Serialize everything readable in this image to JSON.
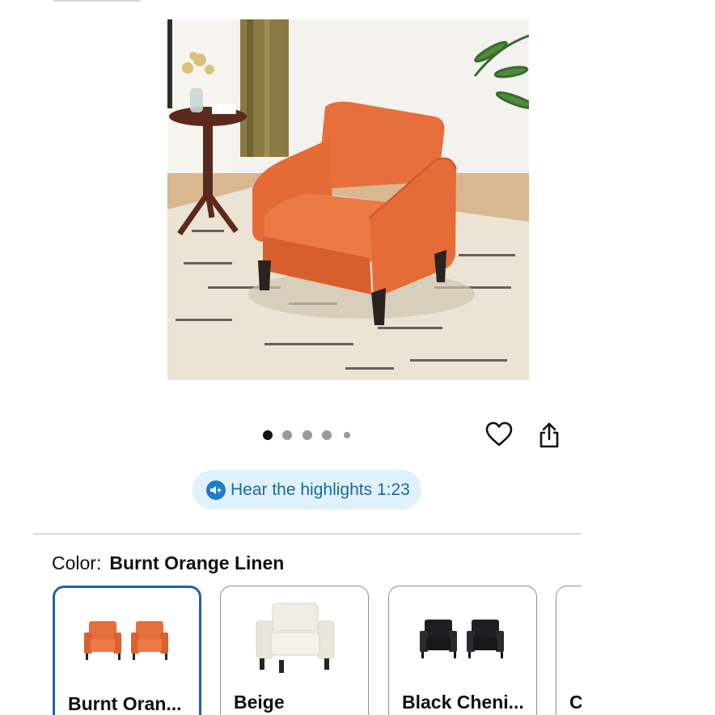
{
  "product": {
    "image_alt": "Burnt orange linen accent chair"
  },
  "carousel": {
    "total": 5,
    "active_index": 0
  },
  "actions": {
    "wishlist_icon": "heart-icon",
    "share_icon": "share-icon"
  },
  "audio": {
    "label": "Hear the highlights 1:23",
    "icon": "audio-sparkle-icon"
  },
  "color": {
    "label": "Color:",
    "selected": "Burnt Orange Linen",
    "options": [
      {
        "name": "Burnt Oran...",
        "selected": true
      },
      {
        "name": "Beige",
        "selected": false
      },
      {
        "name": "Black Cheni...",
        "selected": false
      },
      {
        "name": "C",
        "selected": false
      }
    ]
  },
  "colors": {
    "accent_blue": "#2162a1",
    "pill_bg": "#dff1fb",
    "pill_text": "#1b6aa0",
    "chair_orange": "#e8713d"
  }
}
